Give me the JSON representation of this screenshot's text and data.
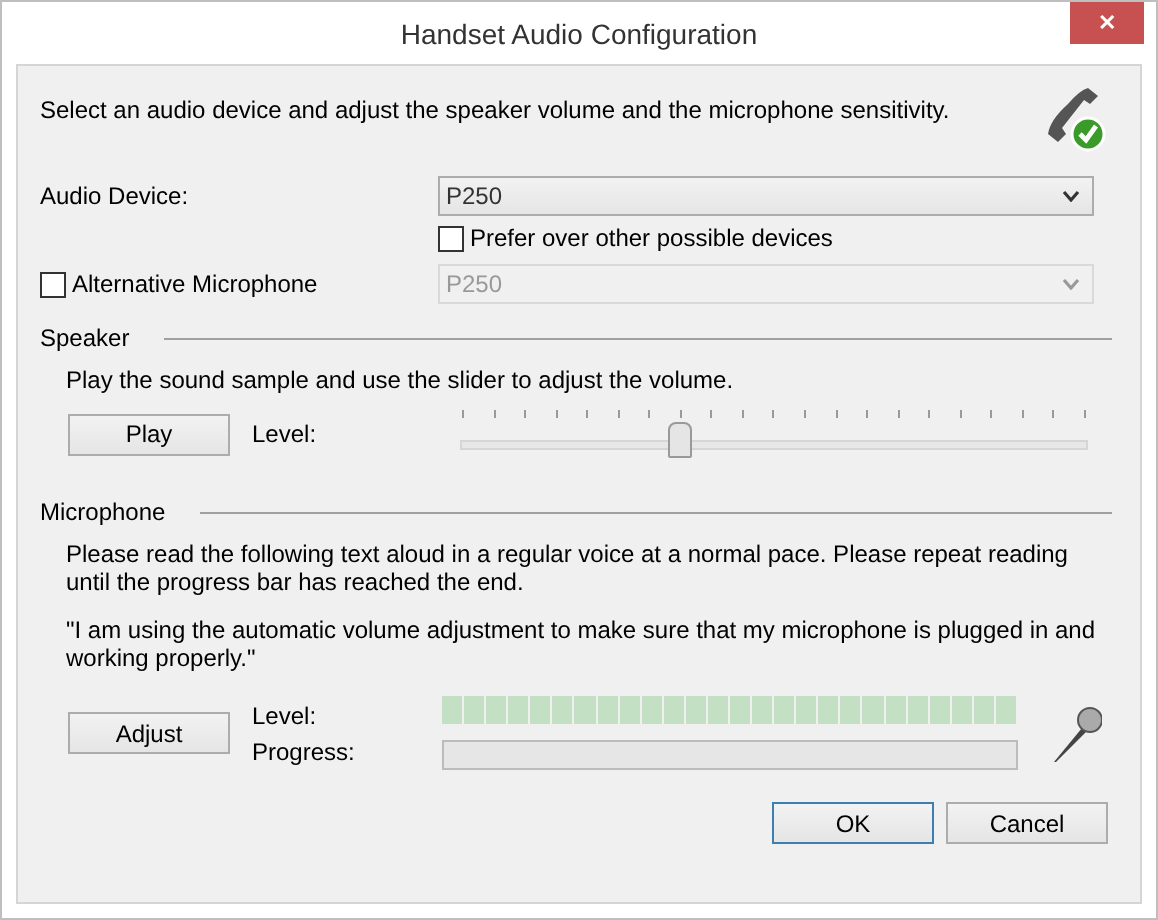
{
  "window": {
    "title": "Handset Audio Configuration",
    "close": "✕"
  },
  "intro": "Select an audio device and adjust the speaker volume and the microphone sensitivity.",
  "audio_device": {
    "label": "Audio Device:",
    "value": "P250",
    "disabled": false
  },
  "prefer": {
    "label": "Prefer over other possible devices",
    "checked": false
  },
  "alternative_microphone": {
    "label": "Alternative Microphone",
    "checked": false,
    "value": "P250",
    "disabled": true
  },
  "speaker": {
    "heading": "Speaker",
    "instruction": "Play the sound sample and use the slider to adjust the volume.",
    "button": "Play",
    "level_label": "Level:",
    "level": 0.35
  },
  "microphone": {
    "heading": "Microphone",
    "instruction": "Please read the following text aloud in a regular voice at a normal pace. Please repeat reading until the progress bar has reached the end.",
    "quote": "\"I am using the automatic volume adjustment to make sure that my microphone is plugged in and working properly.\"",
    "button": "Adjust",
    "level_label": "Level:",
    "meter": {
      "level": 0
    },
    "progress_label": "Progress:",
    "progress": {
      "level": 0
    }
  },
  "buttons": [
    {
      "label": "OK",
      "default": true
    },
    {
      "label": "Cancel",
      "default": false
    }
  ]
}
